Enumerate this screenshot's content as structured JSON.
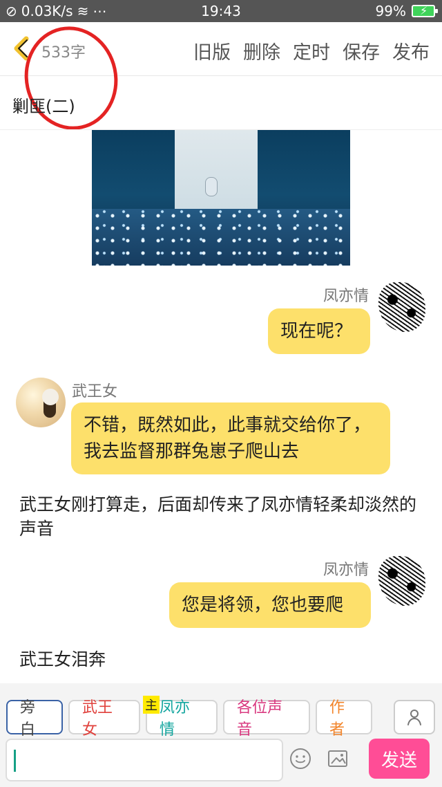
{
  "status_bar": {
    "speed": "0.03K/s",
    "time": "19:43",
    "battery": "99%"
  },
  "top_bar": {
    "word_count": "533字",
    "actions": [
      "旧版",
      "删除",
      "定时",
      "保存",
      "发布"
    ]
  },
  "title": "剿匪(二)",
  "messages": [
    {
      "speaker": "凤亦情",
      "text": "现在呢？",
      "side": "right"
    },
    {
      "speaker": "武王女",
      "text": "不错，既然如此，此事就交给你了，我去监督那群兔崽子爬山去",
      "side": "left"
    },
    {
      "narration": "武王女刚打算走，后面却传来了凤亦情轻柔却淡然的声音"
    },
    {
      "speaker": "凤亦情",
      "text": "您是将领，您也要爬",
      "side": "right"
    },
    {
      "narration": "武王女泪奔"
    }
  ],
  "chips": {
    "items": [
      "旁白",
      "武王女",
      "凤亦情",
      "各位声音",
      "作者"
    ],
    "badge": "主"
  },
  "input": {
    "send_label": "发送"
  },
  "icons": {
    "back": "back-chevron-icon",
    "profile": "profile-icon",
    "emoji": "emoji-icon",
    "image": "image-icon"
  },
  "colors": {
    "accent": "#fde06b",
    "send": "#ff4d96",
    "annotation": "#e42323"
  }
}
